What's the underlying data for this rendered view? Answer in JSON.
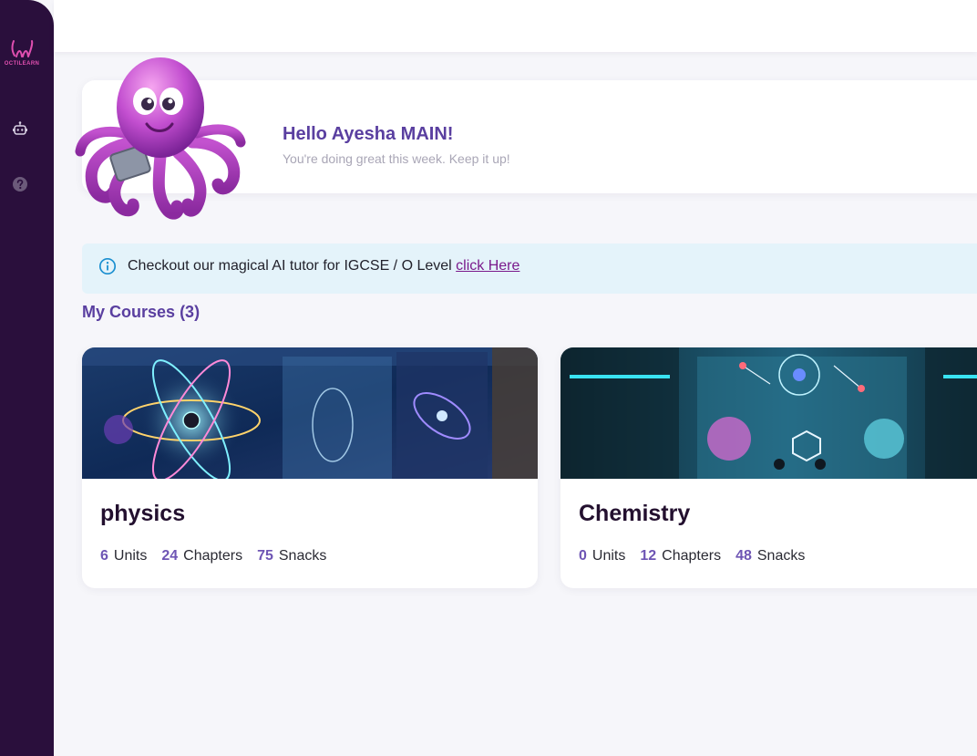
{
  "brand": {
    "logo_text": "OCTILEARN"
  },
  "sidebar": {
    "items": [
      {
        "icon": "robot-icon"
      },
      {
        "icon": "help-icon"
      }
    ]
  },
  "greeting": {
    "title": "Hello Ayesha MAIN!",
    "subtitle": "You're doing great this week. Keep it up!"
  },
  "banner": {
    "text": "Checkout our magical AI tutor for IGCSE / O Level",
    "link_label": "click Here"
  },
  "courses": {
    "heading_label": "My Courses",
    "heading_count": "(3)",
    "items": [
      {
        "title": "physics",
        "units": "6",
        "units_label": "Units",
        "chapters": "24",
        "chapters_label": "Chapters",
        "snacks": "75",
        "snacks_label": "Snacks"
      },
      {
        "title": "Chemistry",
        "units": "0",
        "units_label": "Units",
        "chapters": "12",
        "chapters_label": "Chapters",
        "snacks": "48",
        "snacks_label": "Snacks"
      }
    ]
  },
  "colors": {
    "sidebar": "#2a0f3c",
    "accent": "#5a3fa0",
    "link": "#7a1a8c",
    "banner_bg": "#e4f3fa"
  }
}
